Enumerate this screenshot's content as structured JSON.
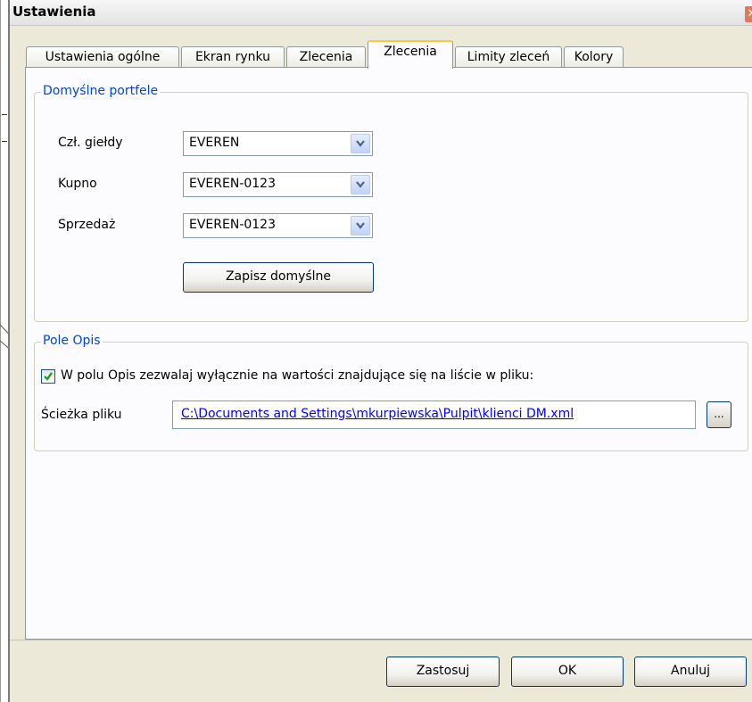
{
  "window": {
    "title": "Ustawienia",
    "close_glyph": "✕"
  },
  "tabs": [
    {
      "label": "Ustawienia ogólne",
      "active": false
    },
    {
      "label": "Ekran rynku",
      "active": false
    },
    {
      "label": "Zlecenia",
      "active": false
    },
    {
      "label": "Zlecenia",
      "active": true
    },
    {
      "label": "Limity zleceń",
      "active": false
    },
    {
      "label": "Kolory",
      "active": false
    }
  ],
  "default_portfolios": {
    "legend": "Domyślne portfele",
    "rows": [
      {
        "label": "Czł. giełdy",
        "value": "EVEREN"
      },
      {
        "label": "Kupno",
        "value": "EVEREN-0123"
      },
      {
        "label": "Sprzedaż",
        "value": "EVEREN-0123"
      }
    ],
    "save_button": "Zapisz domyślne"
  },
  "description_field": {
    "legend": "Pole Opis",
    "checkbox_label": "W polu Opis zezwalaj wyłącznie na wartości znajdujące się na liście w pliku:",
    "checked": true,
    "path_label": "Ścieżka pliku",
    "path_value": "C:\\Documents and Settings\\mkurpiewska\\Pulpit\\klienci DM.xml",
    "browse_label": "..."
  },
  "footer": {
    "apply": "Zastosuj",
    "ok": "OK",
    "cancel": "Anuluj"
  },
  "colors": {
    "accent_blue": "#0046d5",
    "link": "#0000ff",
    "tab_highlight": "#ffc83c",
    "check_green": "#21a121"
  }
}
